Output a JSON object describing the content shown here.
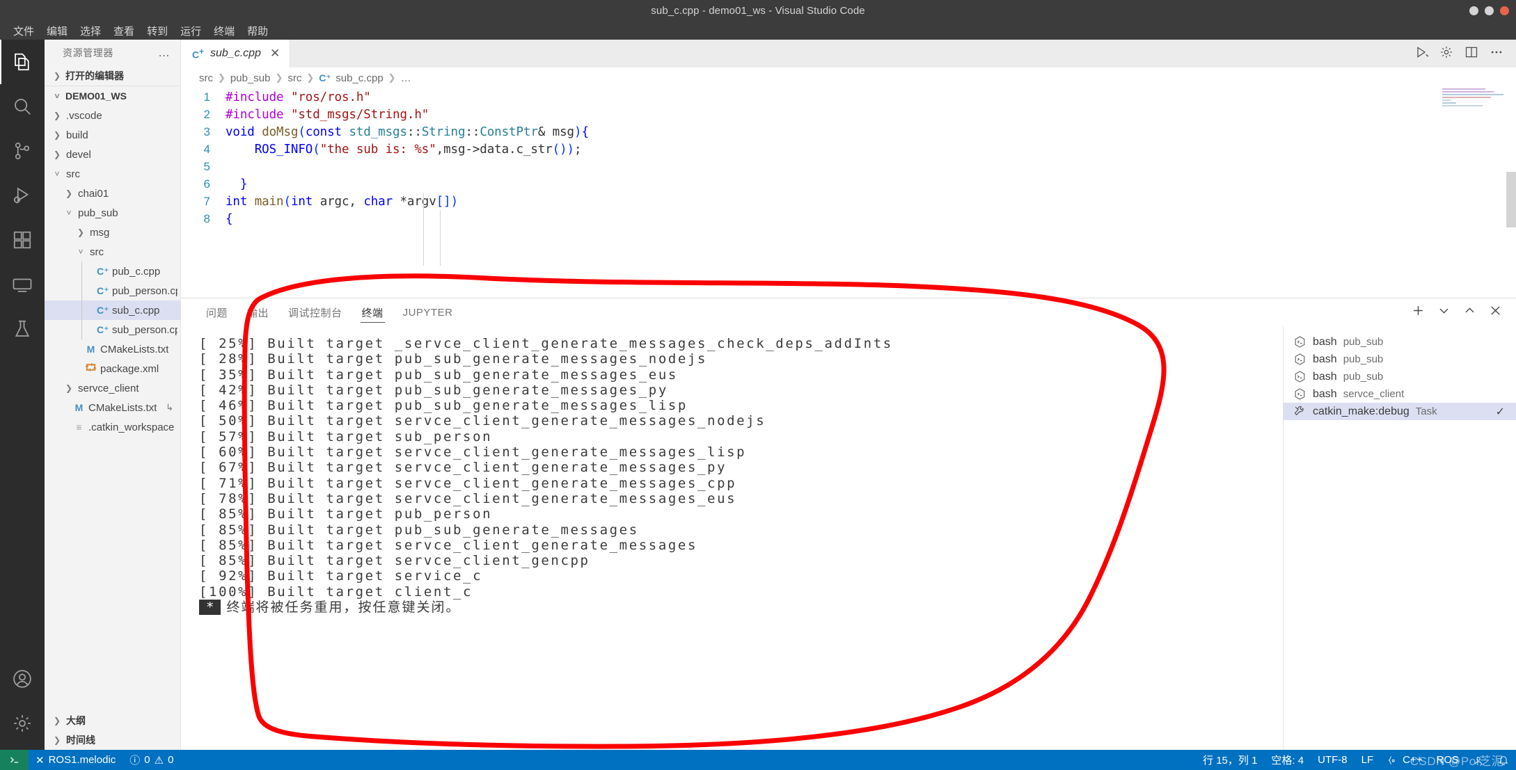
{
  "window": {
    "title": "sub_c.cpp - demo01_ws - Visual Studio Code"
  },
  "menubar": {
    "items": [
      "文件",
      "编辑",
      "选择",
      "查看",
      "转到",
      "运行",
      "终端",
      "帮助"
    ]
  },
  "activitybar": {
    "items": [
      {
        "name": "explorer-icon",
        "label": "资源管理器"
      },
      {
        "name": "search-icon",
        "label": "搜索"
      },
      {
        "name": "source-control-icon",
        "label": "源代码管理"
      },
      {
        "name": "run-debug-icon",
        "label": "运行和调试"
      },
      {
        "name": "extensions-icon",
        "label": "扩展"
      },
      {
        "name": "remote-explorer-icon",
        "label": "远程资源管理器"
      },
      {
        "name": "testing-icon",
        "label": "测试"
      }
    ],
    "bottom": [
      {
        "name": "accounts-icon",
        "label": "账户"
      },
      {
        "name": "manage-gear-icon",
        "label": "管理"
      }
    ]
  },
  "sidebar": {
    "title": "资源管理器",
    "more_label": "…",
    "open_editors": "打开的编辑器",
    "workspace": "DEMO01_WS",
    "tree": [
      {
        "label": ".vscode",
        "depth": 1,
        "type": "folder",
        "state": "collapsed"
      },
      {
        "label": "build",
        "depth": 1,
        "type": "folder",
        "state": "collapsed"
      },
      {
        "label": "devel",
        "depth": 1,
        "type": "folder",
        "state": "collapsed"
      },
      {
        "label": "src",
        "depth": 1,
        "type": "folder",
        "state": "expanded"
      },
      {
        "label": "chai01",
        "depth": 2,
        "type": "folder",
        "state": "collapsed"
      },
      {
        "label": "pub_sub",
        "depth": 2,
        "type": "folder",
        "state": "expanded"
      },
      {
        "label": "msg",
        "depth": 3,
        "type": "folder",
        "state": "collapsed"
      },
      {
        "label": "src",
        "depth": 3,
        "type": "folder",
        "state": "expanded"
      },
      {
        "label": "pub_c.cpp",
        "depth": 4,
        "type": "cpp"
      },
      {
        "label": "pub_person.cpp",
        "depth": 4,
        "type": "cpp"
      },
      {
        "label": "sub_c.cpp",
        "depth": 4,
        "type": "cpp",
        "selected": true
      },
      {
        "label": "sub_person.cpp",
        "depth": 4,
        "type": "cpp"
      },
      {
        "label": "CMakeLists.txt",
        "depth": 3,
        "type": "m"
      },
      {
        "label": "package.xml",
        "depth": 3,
        "type": "xml"
      },
      {
        "label": "servce_client",
        "depth": 2,
        "type": "folder",
        "state": "collapsed"
      },
      {
        "label": "CMakeLists.txt",
        "depth": 2,
        "type": "m",
        "trailing": "↳"
      },
      {
        "label": ".catkin_workspace",
        "depth": 2,
        "type": "txt"
      }
    ],
    "bottom_sections": [
      "大纲",
      "时间线"
    ]
  },
  "editor": {
    "tab": {
      "label": "sub_c.cpp",
      "icon": "cpp-icon",
      "close": "✕"
    },
    "actions": [
      "run-dropdown-icon",
      "split-editor-icon",
      "settings-gear-icon",
      "more-actions-icon"
    ],
    "breadcrumb": [
      "src",
      "pub_sub",
      "src",
      "sub_c.cpp",
      "…"
    ],
    "lines": [
      {
        "n": "1",
        "tokens": [
          {
            "t": "#include ",
            "c": "k-purple"
          },
          {
            "t": "\"ros/ros.h\"",
            "c": "k-str"
          }
        ]
      },
      {
        "n": "2",
        "tokens": [
          {
            "t": "#include ",
            "c": "k-purple"
          },
          {
            "t": "\"std_msgs/String.h\"",
            "c": "k-str"
          }
        ]
      },
      {
        "n": "3",
        "tokens": [
          {
            "t": "void ",
            "c": "k-blue"
          },
          {
            "t": "doMsg",
            "c": "k-fn"
          },
          {
            "t": "(",
            "c": "k-paren"
          },
          {
            "t": "const ",
            "c": "k-blue"
          },
          {
            "t": "std_msgs",
            "c": "k-type"
          },
          {
            "t": "::",
            "c": "k-plain"
          },
          {
            "t": "String",
            "c": "k-type"
          },
          {
            "t": "::",
            "c": "k-plain"
          },
          {
            "t": "ConstPtr",
            "c": "k-type"
          },
          {
            "t": "& msg",
            "c": "k-plain"
          },
          {
            "t": ")",
            "c": "k-paren"
          },
          {
            "t": "{",
            "c": "k-blue"
          }
        ]
      },
      {
        "n": "4",
        "tokens": [
          {
            "t": "    ",
            "c": "k-plain"
          },
          {
            "t": "ROS_INFO",
            "c": "k-blue"
          },
          {
            "t": "(",
            "c": "k-paren"
          },
          {
            "t": "\"the sub is: %s\"",
            "c": "k-str"
          },
          {
            "t": ",msg->data.c_str",
            "c": "k-plain"
          },
          {
            "t": "())",
            "c": "k-paren"
          },
          {
            "t": ";",
            "c": "k-plain"
          }
        ]
      },
      {
        "n": "5",
        "tokens": []
      },
      {
        "n": "6",
        "tokens": [
          {
            "t": "  }",
            "c": "k-blue"
          }
        ]
      },
      {
        "n": "7",
        "tokens": [
          {
            "t": "int ",
            "c": "k-blue"
          },
          {
            "t": "main",
            "c": "k-fn"
          },
          {
            "t": "(",
            "c": "k-paren"
          },
          {
            "t": "int ",
            "c": "k-blue"
          },
          {
            "t": "argc, ",
            "c": "k-plain"
          },
          {
            "t": "char ",
            "c": "k-blue"
          },
          {
            "t": "*argv",
            "c": "k-plain"
          },
          {
            "t": "[]",
            "c": "k-paren"
          },
          {
            "t": ")",
            "c": "k-paren"
          }
        ]
      },
      {
        "n": "8",
        "tokens": [
          {
            "t": "{",
            "c": "k-blue"
          }
        ]
      }
    ]
  },
  "panel": {
    "tabs": [
      {
        "label": "问题",
        "active": false
      },
      {
        "label": "输出",
        "active": false
      },
      {
        "label": "调试控制台",
        "active": false
      },
      {
        "label": "终端",
        "active": true
      },
      {
        "label": "JUPYTER",
        "active": false
      }
    ],
    "actions": [
      "add-terminal-icon",
      "terminal-dropdown-icon",
      "maximize-panel-icon",
      "close-panel-icon"
    ],
    "terminal_lines": [
      "[ 25%] Built target _servce_client_generate_messages_check_deps_addInts",
      "[ 28%] Built target pub_sub_generate_messages_nodejs",
      "[ 35%] Built target pub_sub_generate_messages_eus",
      "[ 42%] Built target pub_sub_generate_messages_py",
      "[ 46%] Built target pub_sub_generate_messages_lisp",
      "[ 50%] Built target servce_client_generate_messages_nodejs",
      "[ 57%] Built target sub_person",
      "[ 60%] Built target servce_client_generate_messages_lisp",
      "[ 67%] Built target servce_client_generate_messages_py",
      "[ 71%] Built target servce_client_generate_messages_cpp",
      "[ 78%] Built target servce_client_generate_messages_eus",
      "[ 85%] Built target pub_person",
      "[ 85%] Built target pub_sub_generate_messages",
      "[ 85%] Built target servce_client_generate_messages",
      "[ 85%] Built target servce_client_gencpp",
      "[ 92%] Built target service_c",
      "[100%] Built target client_c"
    ],
    "terminal_footer": {
      "marker": "*",
      "text": "终端将被任务重用，按任意键关闭。"
    },
    "terminal_list": [
      {
        "icon": "bash-icon",
        "name": "bash",
        "detail": "pub_sub",
        "selected": false
      },
      {
        "icon": "bash-icon",
        "name": "bash",
        "detail": "pub_sub",
        "selected": false
      },
      {
        "icon": "bash-icon",
        "name": "bash",
        "detail": "pub_sub",
        "selected": false
      },
      {
        "icon": "bash-icon",
        "name": "bash",
        "detail": "servce_client",
        "selected": false
      },
      {
        "icon": "task-tools-icon",
        "name": "catkin_make:debug",
        "detail": "Task",
        "selected": true,
        "check": "✓"
      }
    ]
  },
  "statusbar": {
    "remote_icon": "remote-window-icon",
    "left": [
      {
        "name": "ros-status",
        "text": "ROS1.melodic",
        "icon": "✕"
      },
      {
        "name": "problems-status",
        "text": "0  0",
        "errors": "0",
        "warnings": "0"
      }
    ],
    "right": [
      {
        "name": "cursor-position",
        "text": "行 15，列 1"
      },
      {
        "name": "indentation",
        "text": "空格: 4"
      },
      {
        "name": "encoding",
        "text": "UTF-8"
      },
      {
        "name": "eol",
        "text": "LF"
      },
      {
        "name": "language-mode",
        "text": "C++"
      },
      {
        "name": "ros-distro",
        "text": "ROS"
      }
    ],
    "watermark": "CSDN @Poi芝泥"
  },
  "colors": {
    "accent": "#0070c1",
    "remote": "#16825d",
    "titlebar": "#3c3c3c",
    "selection": "#dcdff2",
    "annotation": "#fa0000"
  }
}
